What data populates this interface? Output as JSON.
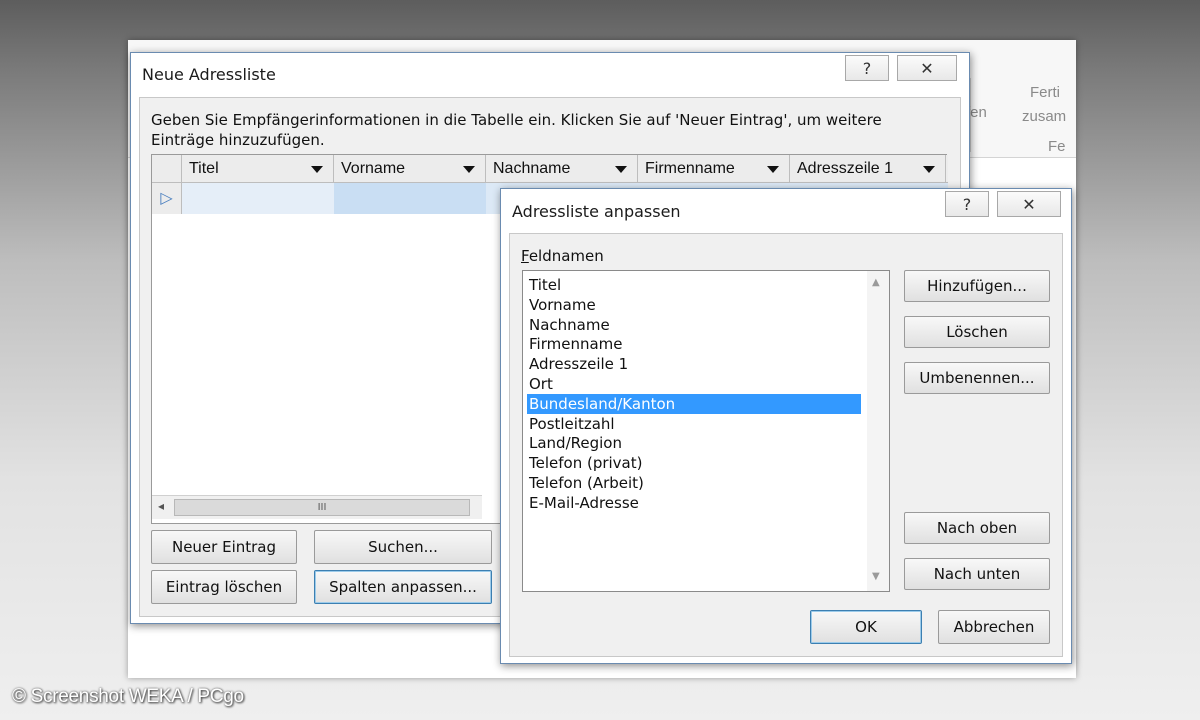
{
  "background_ribbon": {
    "frag1": "fen",
    "frag2": "Ferti",
    "frag3": "zusam",
    "frag4": "Fe"
  },
  "dialog_main": {
    "title": "Neue Adressliste",
    "help_label": "?",
    "close_label": "✕",
    "instruction": "Geben Sie Empfängerinformationen in die Tabelle ein. Klicken Sie auf 'Neuer Eintrag', um weitere Einträge hinzuzufügen.",
    "columns": [
      "Titel",
      "Vorname",
      "Nachname",
      "Firmenname",
      "Adresszeile 1"
    ],
    "row_marker": "▷",
    "scroll_left": "◂",
    "scroll_thumb": "III",
    "buttons": {
      "new_entry": "Neuer Eintrag",
      "search": "Suchen...",
      "delete_entry": "Eintrag löschen",
      "customize_columns": "Spalten anpassen..."
    }
  },
  "dialog_custom": {
    "title": "Adressliste anpassen",
    "help_label": "?",
    "close_label": "✕",
    "field_names_label": "Feldnamen",
    "fields": [
      "Titel",
      "Vorname",
      "Nachname",
      "Firmenname",
      "Adresszeile 1",
      "Ort",
      "Bundesland/Kanton",
      "Postleitzahl",
      "Land/Region",
      "Telefon (privat)",
      "Telefon (Arbeit)",
      "E-Mail-Adresse"
    ],
    "selected_index": 6,
    "scroll_up": "▲",
    "scroll_down": "▼",
    "buttons": {
      "add": "Hinzufügen...",
      "delete": "Löschen",
      "rename": "Umbenennen...",
      "move_up": "Nach oben",
      "move_down": "Nach unten",
      "ok": "OK",
      "cancel": "Abbrechen"
    }
  },
  "watermark": "© Screenshot WEKA / PCgo",
  "colors": {
    "selection": "#3399ff",
    "row_highlight": "#dce9f6",
    "focus_border": "#3c7fb1"
  }
}
